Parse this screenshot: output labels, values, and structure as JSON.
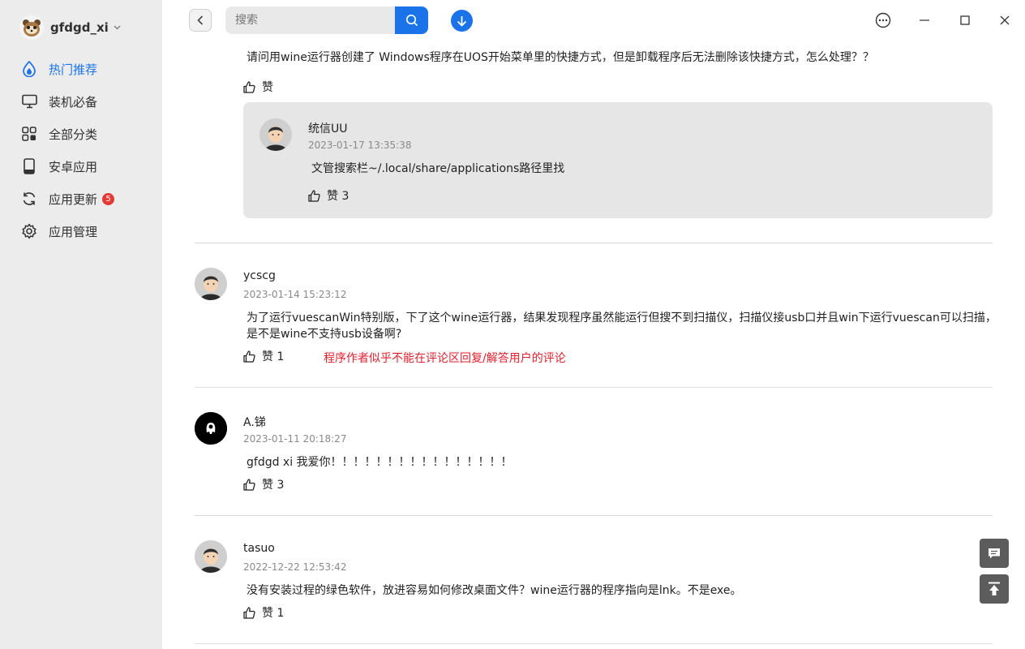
{
  "user": {
    "name": "gfdgd_xi"
  },
  "nav": [
    {
      "label": "热门推荐",
      "icon": "hot-drop-icon"
    },
    {
      "label": "装机必备",
      "icon": "monitor-icon"
    },
    {
      "label": "全部分类",
      "icon": "grid-icon"
    },
    {
      "label": "安卓应用",
      "icon": "phone-icon"
    },
    {
      "label": "应用更新",
      "icon": "refresh-icon",
      "badge": "5"
    },
    {
      "label": "应用管理",
      "icon": "gear-icon"
    }
  ],
  "search": {
    "placeholder": "搜索"
  },
  "comments": [
    {
      "text": "请问用wine运行器创建了 Windows程序在UOS开始菜单里的快捷方式，但是卸载程序后无法删除该快捷方式，怎么处理？？",
      "like_label": "赞",
      "reply": {
        "user": "统信UU",
        "time": "2023-01-17 13:35:38",
        "text": "文管搜索栏~/.local/share/applications路径里找",
        "like_label": "赞 3"
      }
    },
    {
      "user": "ycscg",
      "time": "2023-01-14 15:23:12",
      "text_line1": "为了运行vuescanWin特别版，下了这个wine运行器，结果发现程序虽然能运行但搜不到扫描仪，扫描仪接usb口并且win下运行vuescan可以扫描，",
      "text_line2": "是不是wine不支持usb设备啊?",
      "like_label": "赞 1",
      "note": "程序作者似乎不能在评论区回复/解答用户的评论"
    },
    {
      "user": "A.锑",
      "time": "2023-01-11 20:18:27",
      "text": "gfdgd xi 我爱你！！！！！！！！！！！！！！！！",
      "like_label": "赞 3"
    },
    {
      "user": "tasuo",
      "time": "2022-12-22 12:53:42",
      "text": "没有安装过程的绿色软件，放进容易如何修改桌面文件？wine运行器的程序指向是lnk。不是exe。",
      "like_label": "赞 1"
    }
  ],
  "colors": {
    "accent": "#1a73e8",
    "note": "#e0202e",
    "badge": "#e53935"
  }
}
